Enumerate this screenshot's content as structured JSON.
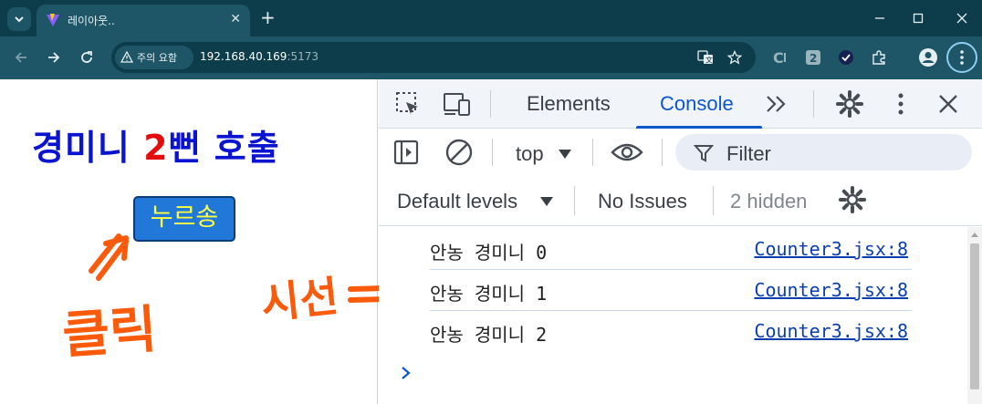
{
  "browser": {
    "tab": {
      "title": "레이아웃.."
    },
    "address": {
      "security_label": "주의 요함",
      "host": "192.168.40.169",
      "port": ":5173"
    }
  },
  "page": {
    "title_pre": "경미니 ",
    "title_num": "2",
    "title_post": "뻔 호출",
    "button_label": "누르송",
    "annotation_click": "클릭",
    "annotation_gaze": "시선"
  },
  "devtools": {
    "tabs": [
      {
        "label": "Elements",
        "active": false
      },
      {
        "label": "Console",
        "active": true
      }
    ],
    "more_tabs": "»",
    "console": {
      "context": "top",
      "filter_placeholder": "Filter",
      "levels": "Default levels",
      "issues": "No Issues",
      "hidden": "2 hidden",
      "messages": [
        {
          "text": "안농 경미니 0",
          "source": "Counter3.jsx:8"
        },
        {
          "text": "안농 경미니 1",
          "source": "Counter3.jsx:8"
        },
        {
          "text": "안농 경미니 2",
          "source": "Counter3.jsx:8"
        }
      ],
      "prompt": ">"
    }
  },
  "colors": {
    "chrome_dark": "#0d3c4b",
    "chrome_mid": "#1e5668",
    "title_blue": "#0a13d0",
    "title_red": "#e30d0d",
    "button_bg": "#2278d8",
    "button_text": "#ffff40",
    "annotation_orange": "#fb5a0a",
    "devtools_accent": "#0b57d0"
  }
}
